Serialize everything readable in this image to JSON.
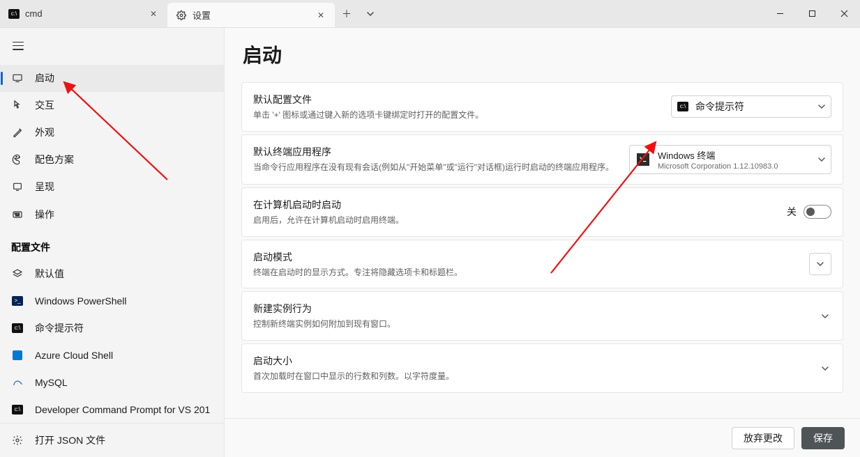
{
  "tabs": [
    {
      "icon": "cmd-badge",
      "label": "cmd"
    },
    {
      "icon": "gear-icon",
      "label": "设置"
    }
  ],
  "sidebar": {
    "items": [
      {
        "icon": "startup-icon",
        "label": "启动",
        "selected": true
      },
      {
        "icon": "interaction-icon",
        "label": "交互"
      },
      {
        "icon": "appearance-icon",
        "label": "外观"
      },
      {
        "icon": "color-icon",
        "label": "配色方案"
      },
      {
        "icon": "rendering-icon",
        "label": "呈现"
      },
      {
        "icon": "actions-icon",
        "label": "操作"
      }
    ],
    "section_header": "配置文件",
    "profiles": [
      {
        "icon": "layers-icon",
        "label": "默认值"
      },
      {
        "icon": "ps-badge",
        "label": "Windows PowerShell"
      },
      {
        "icon": "cmd-badge",
        "label": "命令提示符"
      },
      {
        "icon": "az-square",
        "label": "Azure Cloud Shell"
      },
      {
        "icon": "mysql-icon",
        "label": "MySQL"
      },
      {
        "icon": "cmd-badge",
        "label": "Developer Command Prompt for VS 201"
      }
    ],
    "open_json": {
      "icon": "gear-icon",
      "label": "打开 JSON 文件"
    }
  },
  "page": {
    "title": "启动",
    "settings": [
      {
        "key": "default_profile",
        "title": "默认配置文件",
        "desc": "单击 '+' 图标或通过键入新的选项卡键绑定时打开的配置文件。",
        "control": "dropdown",
        "value_icon": "cmd-badge",
        "value_label": "命令提示符"
      },
      {
        "key": "default_terminal",
        "title": "默认终端应用程序",
        "desc": "当命令行应用程序在没有现有会话(例如从\"开始菜单\"或\"运行\"对话框)运行时启动的终端应用程序。",
        "control": "wide-dropdown",
        "value_icon": "wt-icon",
        "value_title": "Windows 终端",
        "value_sub": "Microsoft Corporation   1.12.10983.0"
      },
      {
        "key": "launch_on_startup",
        "title": "在计算机启动时启动",
        "desc": "启用后，允许在计算机启动时启用终端。",
        "control": "toggle",
        "toggle_label": "关",
        "toggle_on": false
      },
      {
        "key": "launch_mode",
        "title": "启动模式",
        "desc": "终端在启动时的显示方式。专注将隐藏选项卡和标题栏。",
        "control": "expand"
      },
      {
        "key": "new_instance",
        "title": "新建实例行为",
        "desc": "控制新终端实例如何附加到现有窗口。",
        "control": "chevron"
      },
      {
        "key": "launch_size",
        "title": "启动大小",
        "desc": "首次加载时在窗口中显示的行数和列数。以字符度量。",
        "control": "chevron"
      }
    ]
  },
  "footer": {
    "discard": "放弃更改",
    "save": "保存"
  }
}
